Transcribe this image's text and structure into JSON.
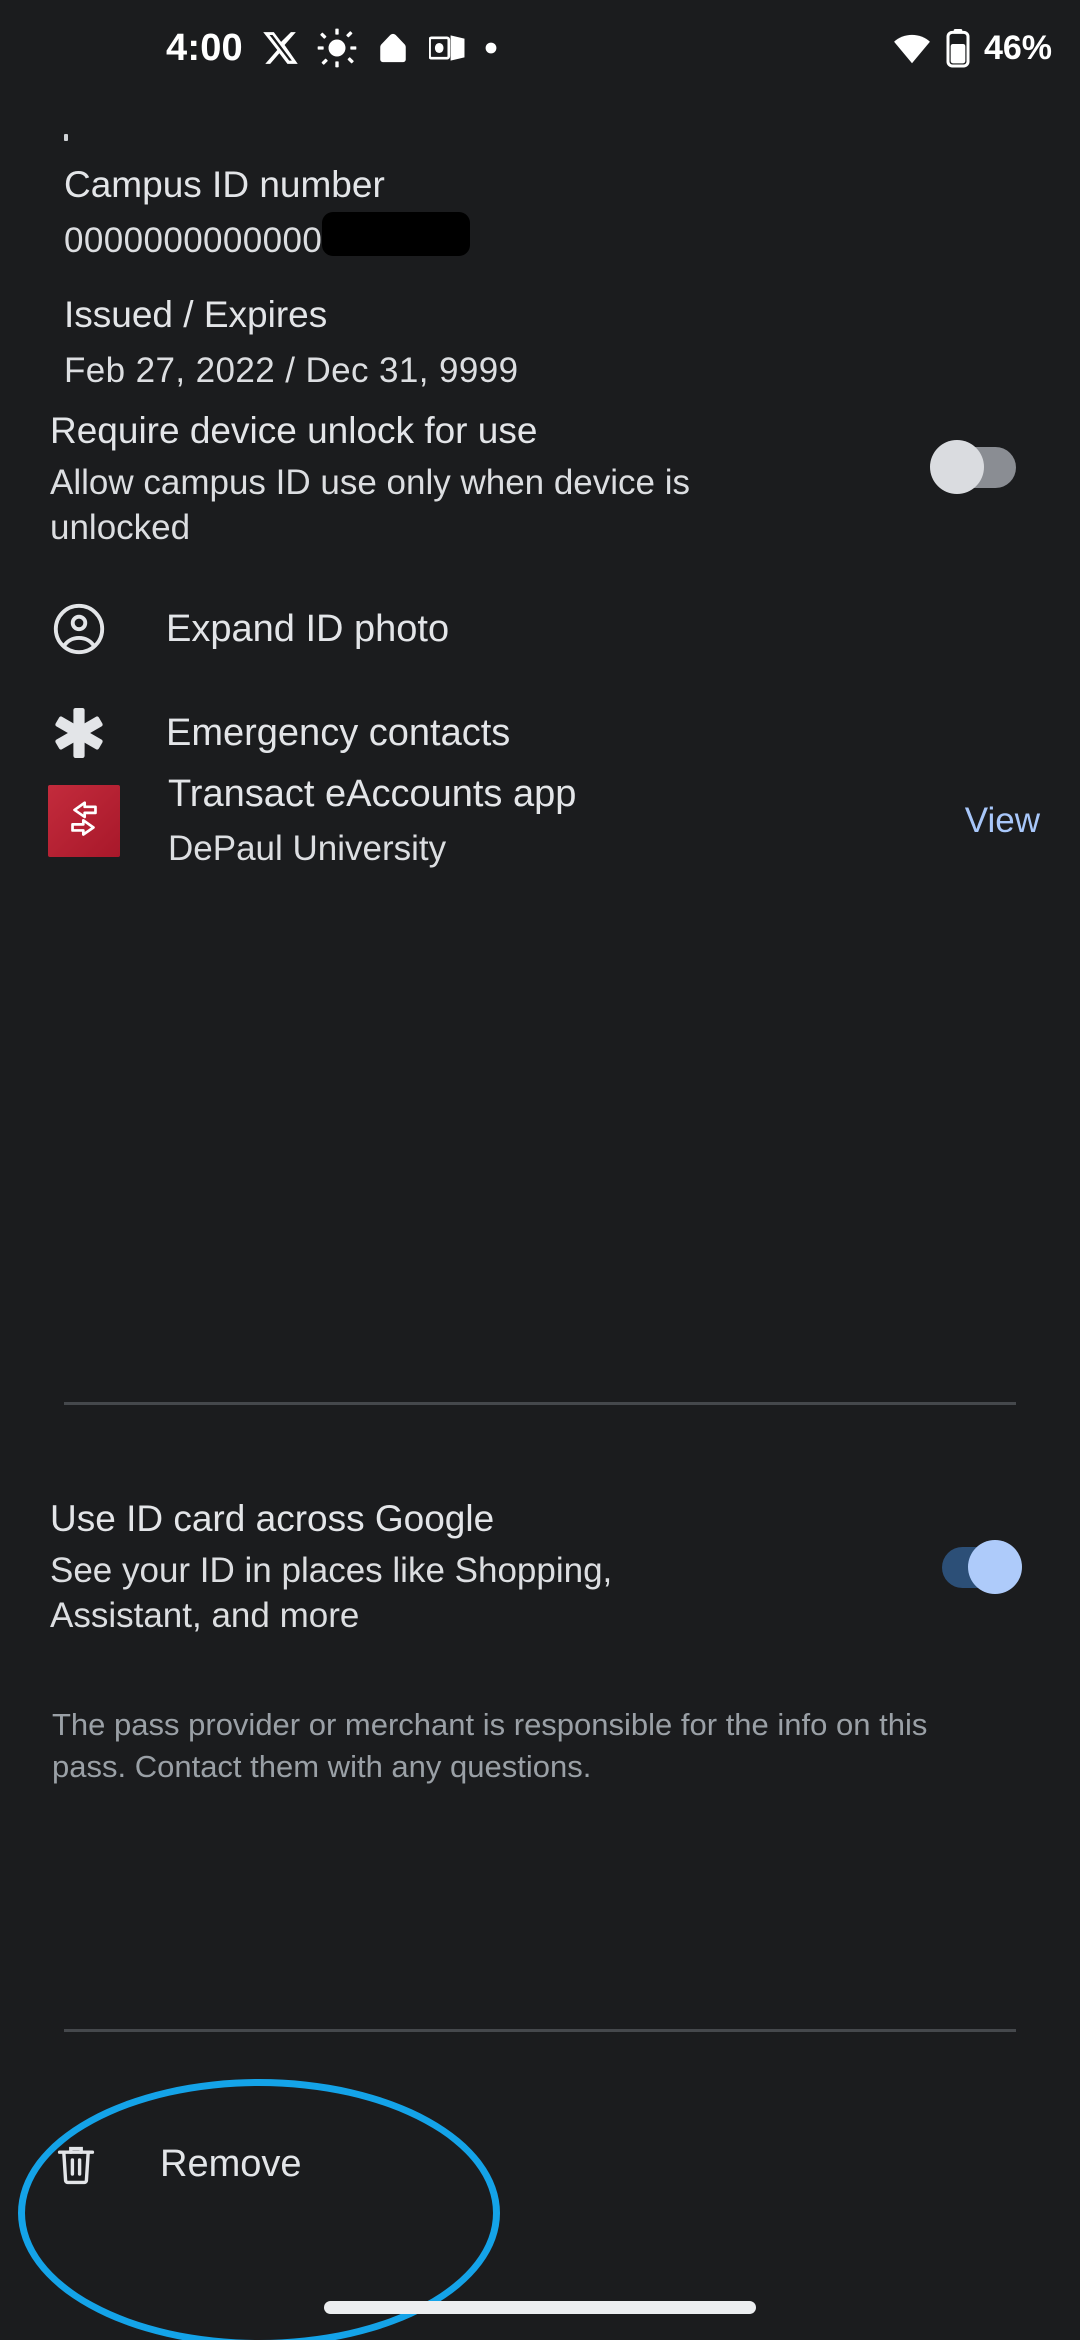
{
  "status_bar": {
    "time": "4:00",
    "battery_percent": "46%",
    "icons": [
      "x-twitter-icon",
      "brightness-sun-icon",
      "google-home-icon",
      "outlook-icon",
      "notification-dot-icon"
    ],
    "right_icons": [
      "wifi-icon",
      "battery-icon"
    ]
  },
  "details": {
    "campus_id": {
      "label": "Campus ID number",
      "value": "00000000000000000",
      "redacted": true
    },
    "issued_expires": {
      "label": "Issued / Expires",
      "value": "Feb 27, 2022 / Dec 31, 9999"
    }
  },
  "require_unlock": {
    "title": "Require device unlock for use",
    "subtitle": "Allow campus ID use only when device is unlocked",
    "state": "off"
  },
  "actions": [
    {
      "label": "Expand ID photo",
      "icon": "account-circle-icon"
    },
    {
      "label": "Emergency contacts",
      "icon": "medical-star-of-life-icon"
    }
  ],
  "app": {
    "title": "Transact eAccounts app",
    "subtitle": "DePaul University",
    "action_label": "View",
    "icon": "transact-eaccounts-app-icon",
    "icon_color": "#bc2433",
    "link_color": "#a8c7fa"
  },
  "use_across_google": {
    "title": "Use ID card across Google",
    "subtitle": "See your ID in places like Shopping, Assistant, and more",
    "state": "on"
  },
  "disclaimer": "The pass provider or merchant is responsible for the info on this pass. Contact them with any questions.",
  "remove": {
    "label": "Remove",
    "icon": "trash-icon",
    "highlight_color": "#14a3e8"
  }
}
